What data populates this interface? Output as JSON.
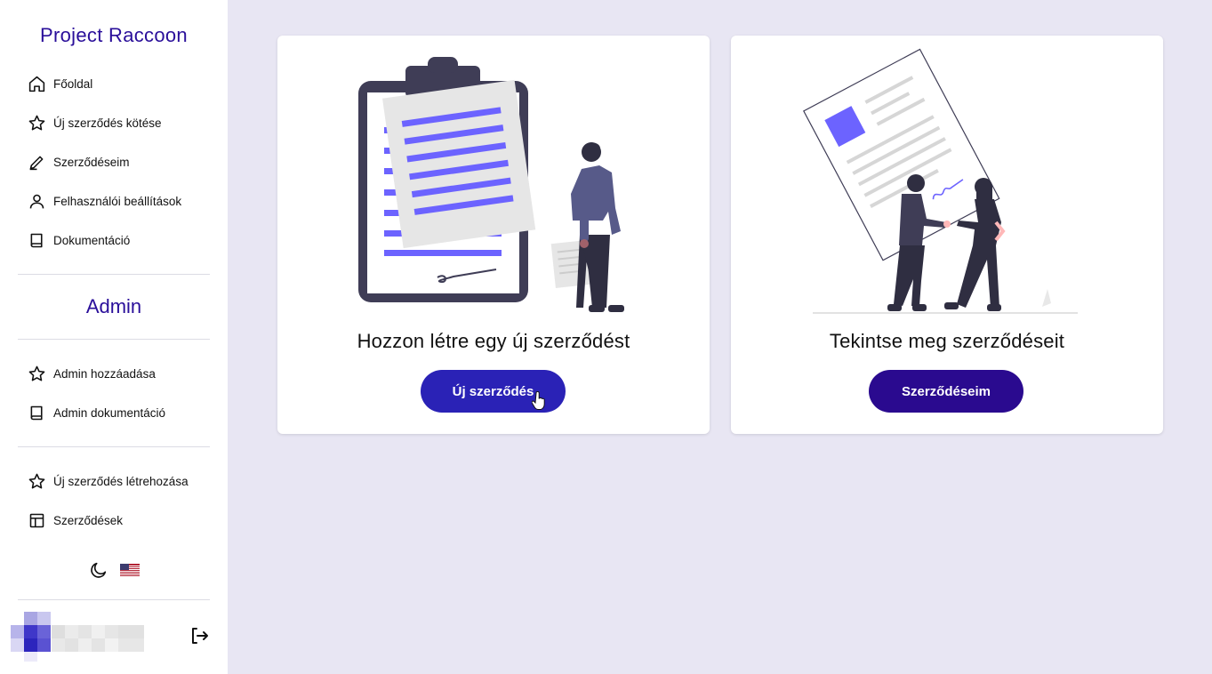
{
  "sidebar": {
    "brand": "Project Raccoon",
    "nav": [
      {
        "label": "Főoldal",
        "icon": "home-icon"
      },
      {
        "label": "Új szerződés kötése",
        "icon": "star-icon"
      },
      {
        "label": "Szerződéseim",
        "icon": "pencil-icon"
      },
      {
        "label": "Felhasználói beállítások",
        "icon": "user-icon"
      },
      {
        "label": "Dokumentáció",
        "icon": "book-icon"
      }
    ],
    "admin_title": "Admin",
    "admin_nav": [
      {
        "label": "Admin hozzáadása",
        "icon": "star-icon"
      },
      {
        "label": "Admin dokumentáció",
        "icon": "book-icon"
      }
    ],
    "extra_nav": [
      {
        "label": "Új szerződés létrehozása",
        "icon": "star-icon"
      },
      {
        "label": "Szerződések",
        "icon": "table-icon"
      }
    ],
    "theme_icon": "moon-icon",
    "language_icon": "us-flag-icon",
    "logout_icon": "logout-icon"
  },
  "cards": [
    {
      "title": "Hozzon létre egy új szerződést",
      "button": "Új szerződés",
      "illustration": "clipboard-illustration"
    },
    {
      "title": "Tekintse meg szerződéseit",
      "button": "Szerződéseim",
      "illustration": "handshake-illustration"
    }
  ],
  "colors": {
    "accent": "#2a0f9a",
    "button_primary": "#2a22b6",
    "button_dark": "#2a0a8f",
    "background": "#e8e6f3",
    "illustration_purple": "#6c63ff"
  }
}
